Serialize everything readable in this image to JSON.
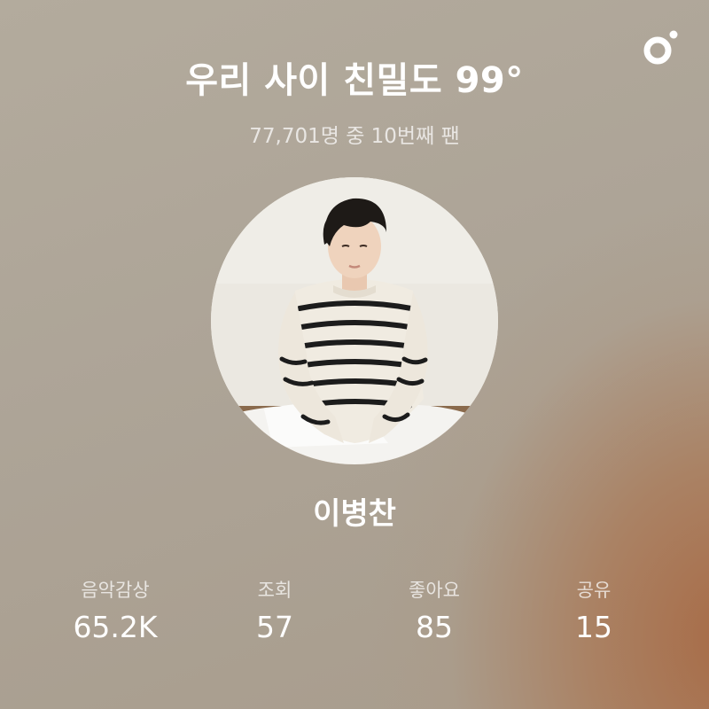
{
  "header": {
    "title": "우리 사이 친밀도 99°",
    "subtitle": "77,701명 중 10번째 팬",
    "logo_icon": "app-logo-icon"
  },
  "artist": {
    "name": "이병찬",
    "photo": "artist-photo"
  },
  "stats": [
    {
      "label": "음악감상",
      "value": "65.2K"
    },
    {
      "label": "조회",
      "value": "57"
    },
    {
      "label": "좋아요",
      "value": "85"
    },
    {
      "label": "공유",
      "value": "15"
    }
  ],
  "colors": {
    "text_primary": "#ffffff",
    "background_base": "#ada497",
    "background_accent": "#a86842"
  }
}
